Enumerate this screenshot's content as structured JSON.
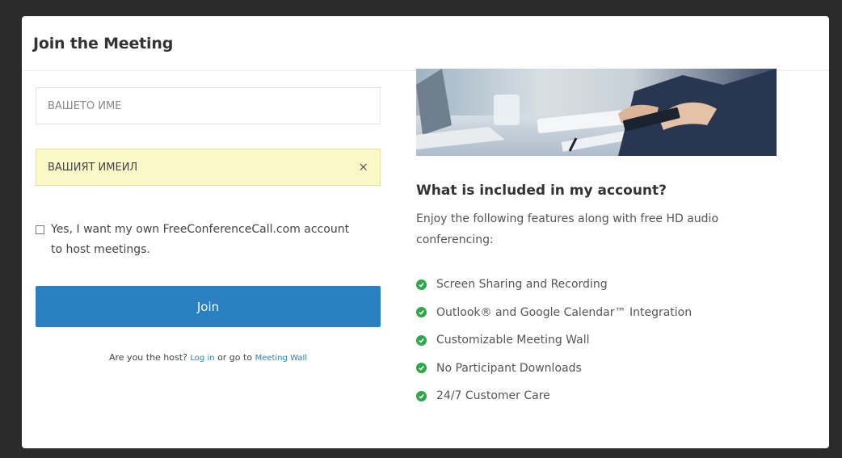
{
  "modal": {
    "title": "Join the Meeting"
  },
  "form": {
    "name_placeholder": "ВАШЕТО ИМЕ",
    "email_value": "ВАШИЯТ ИМЕЙЛ",
    "clear_symbol": "×",
    "checkbox_label": "Yes, I want my own FreeConferenceCall.com account to host meetings.",
    "join_label": "Join",
    "host_prompt": "Are you the host?",
    "login_link": "Log in",
    "host_or_text": "or go to",
    "meeting_wall_link": "Meeting Wall"
  },
  "info": {
    "title": "What is included in my account?",
    "description": "Enjoy the following features along with free HD audio conferencing:",
    "features": [
      "Screen Sharing and Recording",
      "Outlook® and Google Calendar™ Integration",
      "Customizable Meeting Wall",
      "No Participant Downloads",
      "24/7 Customer Care"
    ]
  },
  "colors": {
    "accent": "#2a80c0",
    "check_green": "#2da84a",
    "autofill_yellow": "#fbf8c8"
  },
  "icons": {
    "feature": "check-circle-icon",
    "clear": "close-icon"
  }
}
